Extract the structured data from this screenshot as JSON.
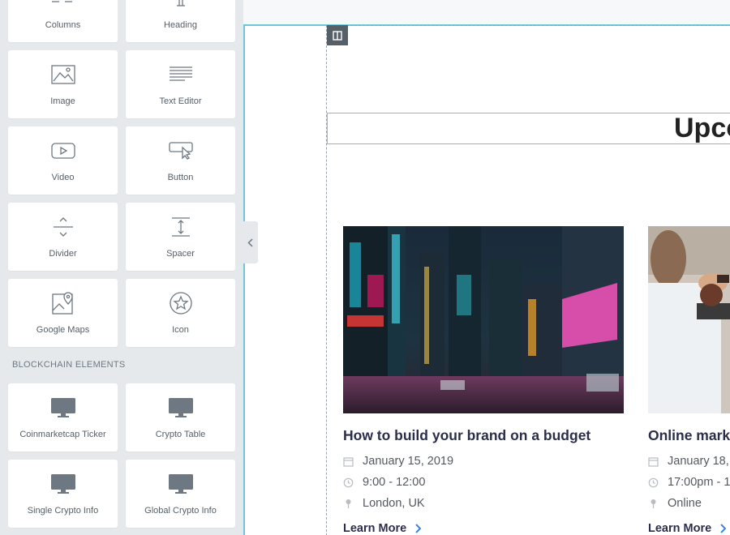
{
  "sidebar": {
    "basic_widgets": [
      {
        "label": "Columns",
        "icon": "columns-icon"
      },
      {
        "label": "Heading",
        "icon": "heading-icon"
      },
      {
        "label": "Image",
        "icon": "image-icon"
      },
      {
        "label": "Text Editor",
        "icon": "text-editor-icon"
      },
      {
        "label": "Video",
        "icon": "video-icon"
      },
      {
        "label": "Button",
        "icon": "button-icon"
      },
      {
        "label": "Divider",
        "icon": "divider-icon"
      },
      {
        "label": "Spacer",
        "icon": "spacer-icon"
      },
      {
        "label": "Google Maps",
        "icon": "google-maps-icon"
      },
      {
        "label": "Icon",
        "icon": "star-icon"
      }
    ],
    "blockchain_section_title": "BLOCKCHAIN ELEMENTS",
    "blockchain_widgets": [
      {
        "label": "Coinmarketcap Ticker",
        "icon": "monitor-icon"
      },
      {
        "label": "Crypto Table",
        "icon": "monitor-icon"
      },
      {
        "label": "Single Crypto Info",
        "icon": "monitor-icon"
      },
      {
        "label": "Global Crypto Info",
        "icon": "monitor-icon"
      }
    ]
  },
  "canvas": {
    "heading": "Upco",
    "events": [
      {
        "title": "How to build your brand on a budget",
        "date": "January 15, 2019",
        "time": "9:00 - 12:00",
        "location": "London, UK",
        "link": "Learn More"
      },
      {
        "title": "Online marke",
        "date": "January 18,",
        "time": "17:00pm - 1",
        "location": "Online",
        "link": "Learn More"
      }
    ]
  },
  "colors": {
    "sidebar_bg": "#e6e9ec",
    "selection_outline": "#6ec7d6",
    "event_title": "#2b2e4a",
    "link_chevron": "#3a84e0"
  }
}
